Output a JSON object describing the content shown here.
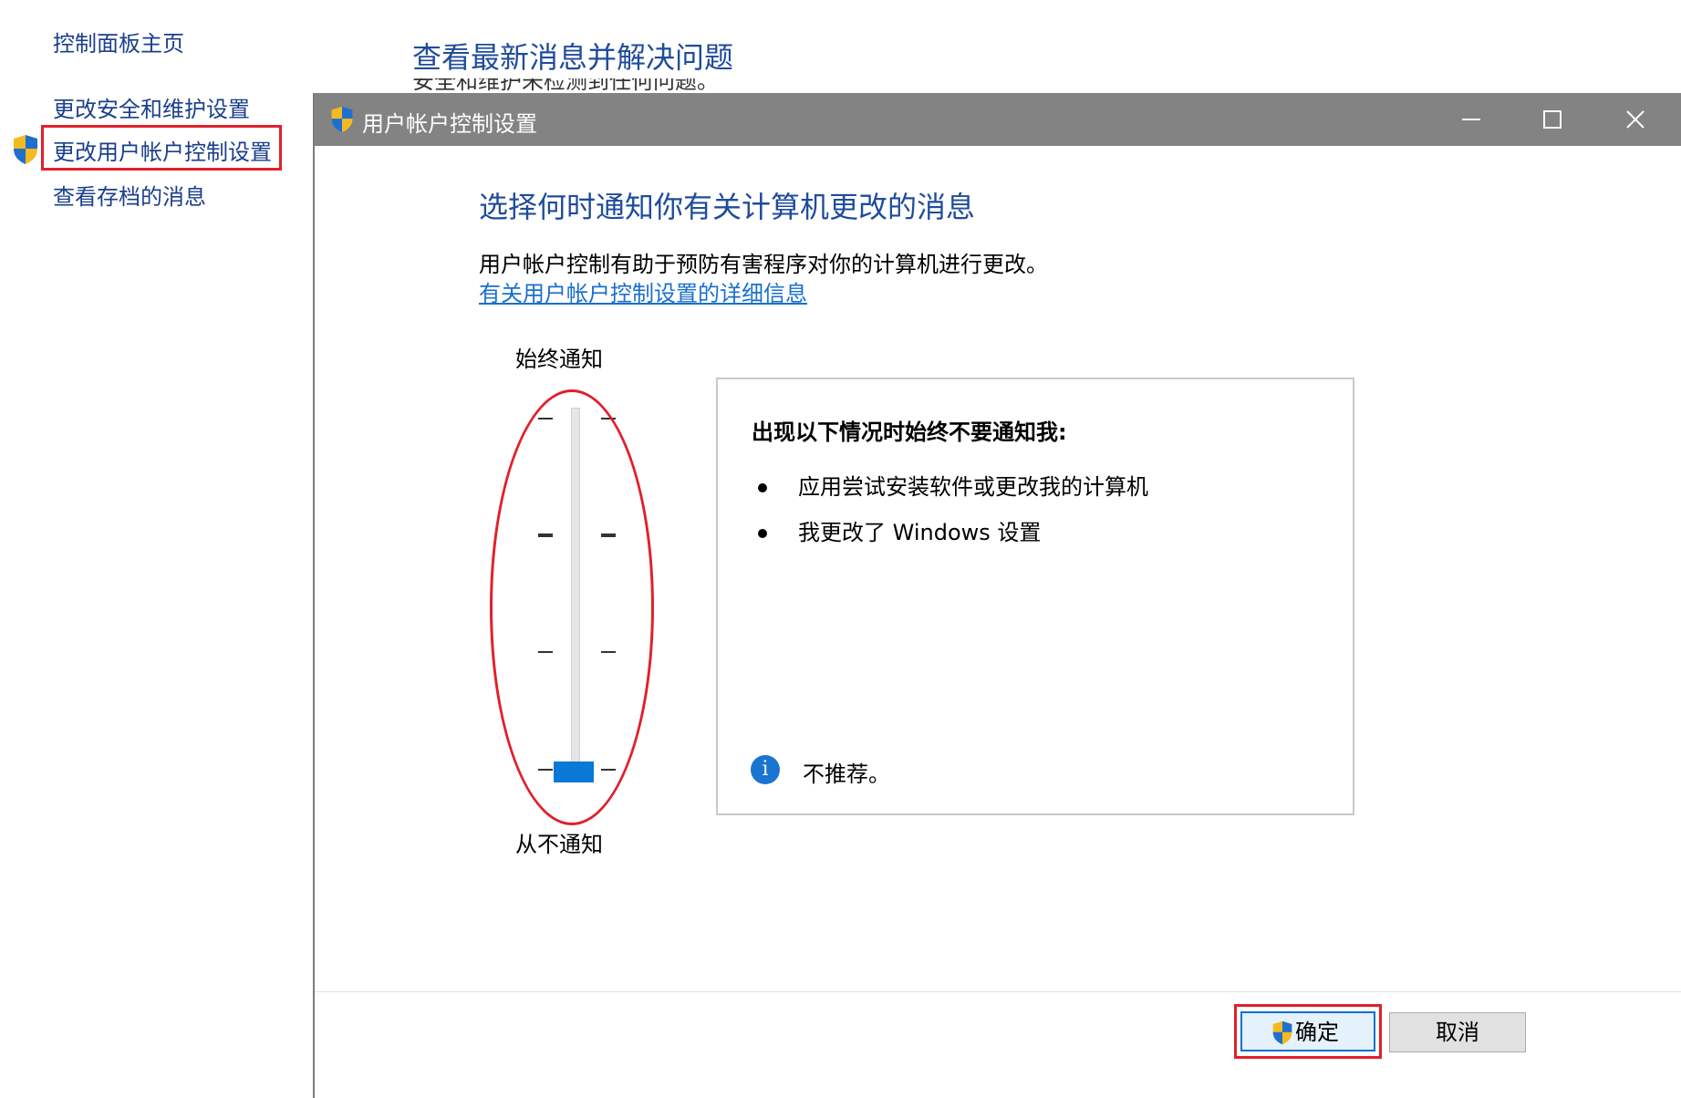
{
  "left_nav": {
    "home": "控制面板主页",
    "items": [
      {
        "label": "更改安全和维护设置"
      },
      {
        "label": "更改用户帐户控制设置",
        "highlighted": true
      },
      {
        "label": "查看存档的消息"
      }
    ]
  },
  "page": {
    "heading": "查看最新消息并解决问题",
    "subtext_partial": "安全和维护未检测到任何问题。"
  },
  "dialog": {
    "title": "用户帐户控制设置",
    "heading": "选择何时通知你有关计算机更改的消息",
    "description": "用户帐户控制有助于预防有害程序对你的计算机进行更改。",
    "link": "有关用户帐户控制设置的详细信息",
    "slider": {
      "top_label": "始终通知",
      "bottom_label": "从不通知",
      "levels": 4,
      "selected_level": 1
    },
    "info": {
      "title": "出现以下情况时始终不要通知我:",
      "bullets": [
        "应用尝试安装软件或更改我的计算机",
        "我更改了 Windows 设置"
      ],
      "note": "不推荐。"
    },
    "buttons": {
      "ok": "确定",
      "cancel": "取消"
    }
  },
  "colors": {
    "titlebar": "#838383",
    "heading_blue": "#1f4c9c",
    "link_blue": "#1a6fcf",
    "slider_thumb": "#0a78d7",
    "annotation_red": "#e0202a"
  },
  "icons": {
    "shield": "uac-shield-icon",
    "info": "info-icon",
    "minimize": "minimize-icon",
    "maximize": "maximize-icon",
    "close": "close-icon"
  }
}
